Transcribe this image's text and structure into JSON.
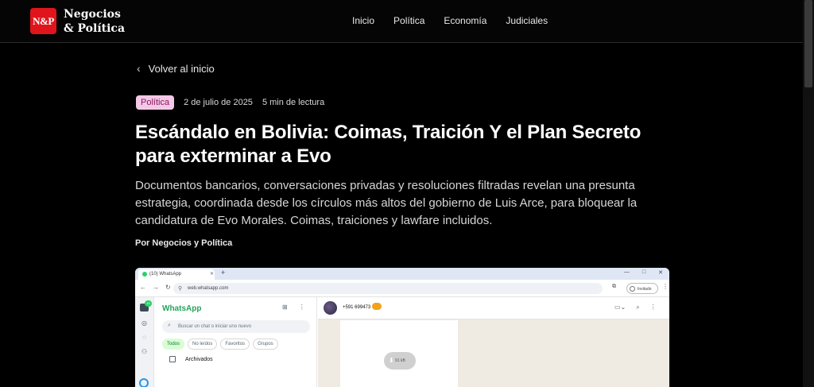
{
  "header": {
    "logo_text": "N&P",
    "brand_line1": "Negocios",
    "brand_line2": "& Política",
    "nav": [
      "Inicio",
      "Política",
      "Economía",
      "Judiciales"
    ]
  },
  "article": {
    "back_label": "Volver al inicio",
    "category": "Política",
    "date": "2 de julio de 2025",
    "read_time": "5 min de lectura",
    "title": "Escándalo en Bolivia: Coimas, Traición Y el Plan Secreto para exterminar a Evo",
    "summary": "Documentos bancarios, conversaciones privadas y resoluciones filtradas revelan una presunta estrategia, coordinada desde los círculos más altos del gobierno de Luis Arce, para bloquear la candidatura de Evo Morales. Coimas, traiciones y lawfare incluidos.",
    "byline": "Por Negocios y Política"
  },
  "embedded_screenshot": {
    "tab_title": "(10) WhatsApp",
    "url": "web.whatsapp.com",
    "profile_label": "Invitado",
    "app_title": "WhatsApp",
    "unread_badge": "10",
    "search_placeholder": "Buscar un chat o iniciar uno nuevo",
    "filters": [
      "Todos",
      "No leídos",
      "Favoritos",
      "Grupos"
    ],
    "archived_label": "Archivados",
    "contact_phone": "+591 699473",
    "download_size": "91 kB"
  },
  "colors": {
    "brand_red": "#e0151c",
    "badge_bg": "#f3c8e6",
    "whatsapp_green": "#25a35a"
  }
}
